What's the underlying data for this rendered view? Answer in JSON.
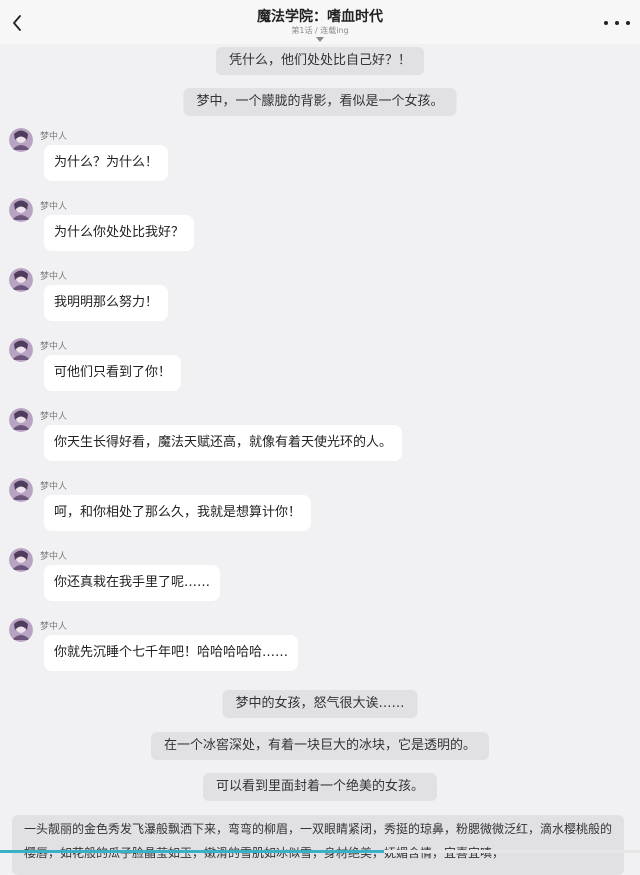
{
  "header": {
    "title": "魔法学院：嗜血时代",
    "subtitle": "第1话 / 连载ing",
    "back_icon": "chevron-left-icon",
    "more_icon": "more-dots-icon"
  },
  "messages": [
    {
      "type": "narration",
      "text": "凭什么，他们处处比自己好？！"
    },
    {
      "type": "narration",
      "text": "梦中，一个朦胧的背影，看似是一个女孩。"
    },
    {
      "type": "dialogue",
      "speaker": "梦中人",
      "text": "为什么？为什么！"
    },
    {
      "type": "dialogue",
      "speaker": "梦中人",
      "text": "为什么你处处比我好？"
    },
    {
      "type": "dialogue",
      "speaker": "梦中人",
      "text": "我明明那么努力！"
    },
    {
      "type": "dialogue",
      "speaker": "梦中人",
      "text": "可他们只看到了你！"
    },
    {
      "type": "dialogue",
      "speaker": "梦中人",
      "text": "你天生长得好看，魔法天赋还高，就像有着天使光环的人。"
    },
    {
      "type": "dialogue",
      "speaker": "梦中人",
      "text": "呵，和你相处了那么久，我就是想算计你！"
    },
    {
      "type": "dialogue",
      "speaker": "梦中人",
      "text": "你还真栽在我手里了呢……"
    },
    {
      "type": "dialogue",
      "speaker": "梦中人",
      "text": "你就先沉睡个七千年吧！哈哈哈哈哈……"
    },
    {
      "type": "narration",
      "text": "梦中的女孩，怒气很大诶……"
    },
    {
      "type": "narration",
      "text": "在一个冰窖深处，有着一块巨大的冰块，它是透明的。"
    },
    {
      "type": "narration",
      "text": "可以看到里面封着一个绝美的女孩。"
    },
    {
      "type": "narration",
      "text": "一头靓丽的金色秀发飞瀑般飘洒下来，弯弯的柳眉，一双眼睛紧闭，秀挺的琼鼻，粉腮微微泛红，滴水樱桃般的樱唇，如花般的瓜子脸晶莹如玉，嫩滑的雪肌如冰似雪，身材绝美，妩媚含情，宜喜宜嗔，"
    }
  ],
  "progress": 0.6,
  "colors": {
    "background": "#f1f1f3",
    "narration_bg": "#e1e1e5",
    "bubble_bg": "#ffffff",
    "progress_fill": "#38b0c8"
  }
}
